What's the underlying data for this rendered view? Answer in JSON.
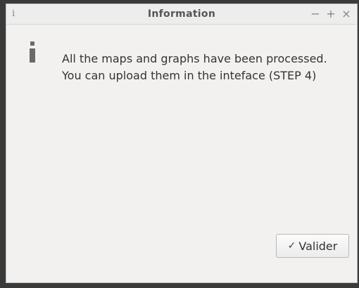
{
  "window": {
    "title": "Information",
    "app_icon_glyph": "i",
    "controls": {
      "minimize": "−",
      "maximize": "+",
      "close": "×"
    }
  },
  "dialog": {
    "icon": "info-icon",
    "message_lines": [
      "All the maps and graphs have been processed.",
      "You can upload them in the inteface (STEP 4)"
    ]
  },
  "buttons": {
    "valider": {
      "icon": "check-icon",
      "icon_glyph": "✓",
      "label": "Valider"
    }
  }
}
